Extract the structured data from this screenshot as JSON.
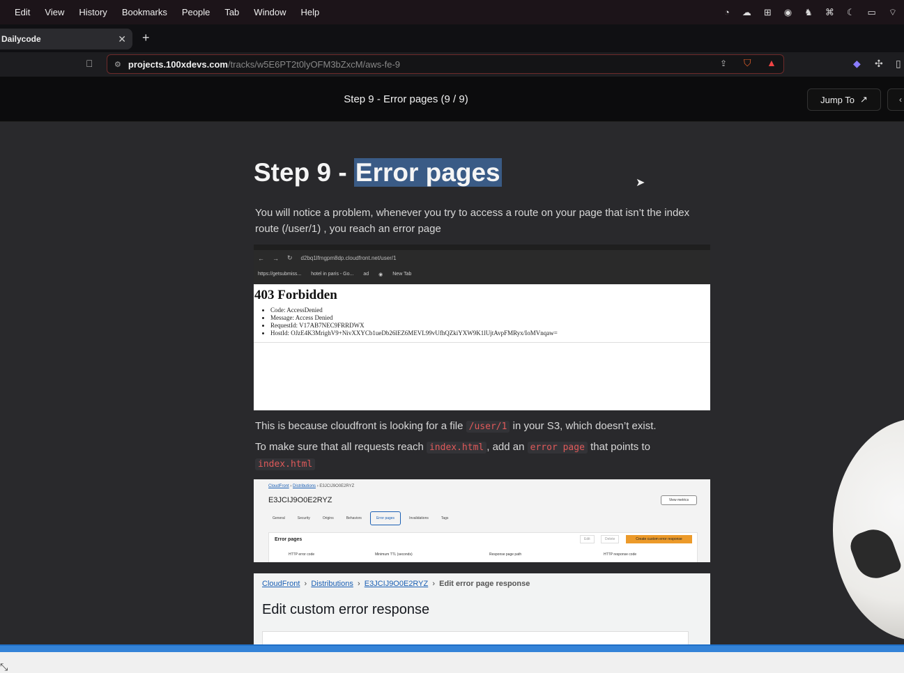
{
  "menubar": {
    "items": [
      "Edit",
      "View",
      "History",
      "Bookmarks",
      "People",
      "Tab",
      "Window",
      "Help"
    ]
  },
  "browser": {
    "tab_title": "Dailycode",
    "tab_close": "✕",
    "new_tab": "+",
    "url_host": "projects.100xdevs.com",
    "url_path": "/tracks/w5E6PT2t0lyOFM3bZxcM/aws-fe-9"
  },
  "header": {
    "title": "Step 9 - Error pages (9 / 9)",
    "jump_label": "Jump To",
    "jump_icon": "↗"
  },
  "article": {
    "heading_prefix": "Step 9 - ",
    "heading_highlight": "Error pages",
    "para1": "You will notice a problem, whenever you try to access a route on your page that isn’t the index route (/user/1) , you reach an error page",
    "para2_a": "This is because cloudfront is looking for a file ",
    "para2_code": "/user/1",
    "para2_b": " in your S3, which doesn’t exist.",
    "para3_a": "To make sure that all requests reach ",
    "para3_code1": "index.html",
    "para3_b": ", add an ",
    "para3_code2": "error page",
    "para3_c": " that points to ",
    "para3_code3": "index.html"
  },
  "shot1": {
    "url": "d2bq1lfmgpm8dp.cloudfront.net/user/1",
    "bookmarks": [
      "https://getsubmiss...",
      "hotel in paris - Go...",
      "ad",
      "",
      "New Tab"
    ],
    "title": "403 Forbidden",
    "items": [
      "Code: AccessDenied",
      "Message: Access Denied",
      "RequestId: V17AB7NEC9FRRDWX",
      "HostId: OJzE4K3MrighV9+NivXXYCb1ueDb26lEZ6MEVL99vUfhQZkiYXW9K1lUjtAvpFMRyx/IoMVnqaw="
    ]
  },
  "shot2": {
    "breadcrumb": [
      "CloudFront",
      "Distributions",
      "E3JCIJ9O0E2RYZ"
    ],
    "distribution": "E3JCIJ9O0E2RYZ",
    "view_metrics": "View metrics",
    "tabs": [
      "General",
      "Security",
      "Origins",
      "Behaviors",
      "Error pages",
      "Invalidations",
      "Tags"
    ],
    "panel_title": "Error pages",
    "edit": "Edit",
    "delete": "Delete",
    "create": "Create custom error response",
    "columns": [
      "HTTP error code",
      "Minimum TTL (seconds)",
      "Response page path",
      "HTTP response code"
    ]
  },
  "shot3": {
    "breadcrumb": [
      "CloudFront",
      "Distributions",
      "E3JCIJ9O0E2RYZ"
    ],
    "current": "Edit error page response",
    "heading": "Edit custom error response"
  }
}
